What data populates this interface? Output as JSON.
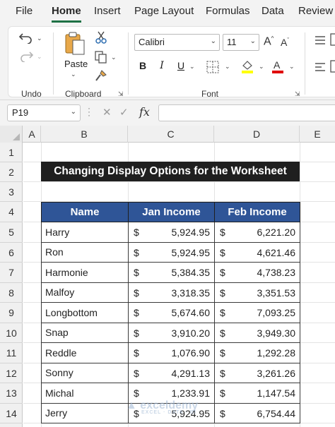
{
  "menu": {
    "items": [
      {
        "label": "File"
      },
      {
        "label": "Home"
      },
      {
        "label": "Insert"
      },
      {
        "label": "Page Layout"
      },
      {
        "label": "Formulas"
      },
      {
        "label": "Data"
      },
      {
        "label": "Review"
      }
    ],
    "active": "Home"
  },
  "ribbon": {
    "undo_group": "Undo",
    "clipboard_group": "Clipboard",
    "paste_label": "Paste",
    "font_group": "Font",
    "font_name": "Calibri",
    "font_size": "11",
    "bold": "B",
    "italic": "I",
    "underline": "U"
  },
  "formula_bar": {
    "name_box": "P19",
    "fx_label": "fx",
    "formula": ""
  },
  "grid": {
    "columns": [
      "A",
      "B",
      "C",
      "D",
      "E"
    ],
    "rows": [
      "1",
      "2",
      "3",
      "4",
      "5",
      "6",
      "7",
      "8",
      "9",
      "10",
      "11",
      "12",
      "13",
      "14"
    ]
  },
  "sheet": {
    "title": "Changing Display Options for the Worksheet",
    "headers": [
      "Name",
      "Jan Income",
      "Feb Income"
    ],
    "currency_symbol": "$",
    "rows": [
      {
        "name": "Harry",
        "jan": "5,924.95",
        "feb": "6,221.20"
      },
      {
        "name": "Ron",
        "jan": "5,924.95",
        "feb": "4,621.46"
      },
      {
        "name": "Harmonie",
        "jan": "5,384.35",
        "feb": "4,738.23"
      },
      {
        "name": "Malfoy",
        "jan": "3,318.35",
        "feb": "3,351.53"
      },
      {
        "name": "Longbottom",
        "jan": "5,674.60",
        "feb": "7,093.25"
      },
      {
        "name": "Snap",
        "jan": "3,910.20",
        "feb": "3,949.30"
      },
      {
        "name": "Reddle",
        "jan": "1,076.90",
        "feb": "1,292.28"
      },
      {
        "name": "Sonny",
        "jan": "4,291.13",
        "feb": "3,261.26"
      },
      {
        "name": "Michal",
        "jan": "1,233.91",
        "feb": "1,147.54"
      },
      {
        "name": "Jerry",
        "jan": "5,924.95",
        "feb": "6,754.44"
      }
    ]
  },
  "watermark": {
    "text": "exceldemy",
    "sub": "EXCEL · DATA · BI"
  },
  "colors": {
    "accent": "#1e7145",
    "header_fill": "#2f5597",
    "title_fill": "#1f1f1f"
  }
}
